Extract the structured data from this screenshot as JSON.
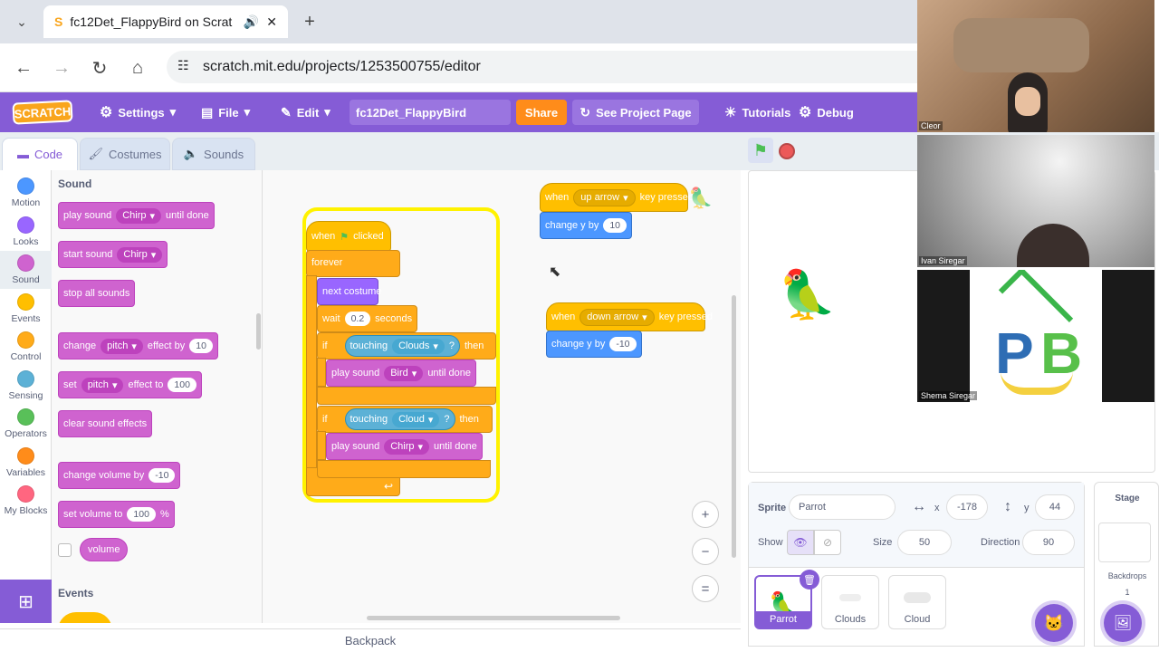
{
  "browser": {
    "tab_title": "fc12Det_FlappyBird on Scrat",
    "url": "scratch.mit.edu/projects/1253500755/editor",
    "icons": [
      "back-icon",
      "forward-icon",
      "reload-icon",
      "home-icon",
      "site-settings-icon",
      "speaker-icon",
      "close-icon",
      "new-tab-icon"
    ]
  },
  "menubar": {
    "logo": "SCRATCH",
    "settings": "Settings",
    "file": "File",
    "edit": "Edit",
    "project_title": "fc12Det_FlappyBird",
    "share": "Share",
    "see_project": "See Project Page",
    "tutorials": "Tutorials",
    "debug": "Debug"
  },
  "tabs": {
    "code": "Code",
    "costumes": "Costumes",
    "sounds": "Sounds"
  },
  "categories": [
    {
      "label": "Motion",
      "color": "#4c97ff"
    },
    {
      "label": "Looks",
      "color": "#9966ff"
    },
    {
      "label": "Sound",
      "color": "#cf63cf"
    },
    {
      "label": "Events",
      "color": "#ffbf00"
    },
    {
      "label": "Control",
      "color": "#ffab19"
    },
    {
      "label": "Sensing",
      "color": "#5cb1d6"
    },
    {
      "label": "Operators",
      "color": "#59c059"
    },
    {
      "label": "Variables",
      "color": "#ff8c1a"
    },
    {
      "label": "My Blocks",
      "color": "#ff6680"
    }
  ],
  "palette": {
    "heading": "Sound",
    "events_heading": "Events",
    "play_until": {
      "a": "play sound",
      "sound": "Chirp",
      "b": "until done"
    },
    "start_sound": {
      "a": "start sound",
      "sound": "Chirp"
    },
    "stop_all": "stop all sounds",
    "change_effect": {
      "a": "change",
      "effect": "pitch",
      "b": "effect by",
      "value": "10"
    },
    "set_effect": {
      "a": "set",
      "effect": "pitch",
      "b": "effect to",
      "value": "100"
    },
    "clear_effects": "clear sound effects",
    "change_volume": {
      "a": "change volume by",
      "value": "-10"
    },
    "set_volume": {
      "a": "set volume to",
      "value": "100",
      "unit": "%"
    },
    "volume": "volume"
  },
  "scripts": {
    "main": {
      "when": "when",
      "clicked": "clicked",
      "forever": "forever",
      "next_costume": "next costume",
      "wait": "wait",
      "wait_value": "0.2",
      "seconds": "seconds",
      "if1": "if",
      "touching": "touching",
      "target1": "Clouds",
      "q": "?",
      "then": "then",
      "play1": "play sound",
      "sound1": "Bird",
      "until": "until done",
      "if2": "if",
      "target2": "Cloud",
      "play2": "play sound",
      "sound2": "Chirp"
    },
    "up": {
      "when": "when",
      "key": "up arrow",
      "pressed": "key pressed",
      "change": "change y by",
      "value": "10"
    },
    "down": {
      "when": "when",
      "key": "down arrow",
      "pressed": "key pressed",
      "change": "change y by",
      "value": "-10"
    }
  },
  "backpack": "Backpack",
  "sprite_info": {
    "sprite_label": "Sprite",
    "sprite_name": "Parrot",
    "x_label": "x",
    "x": "-178",
    "y_label": "y",
    "y": "44",
    "show_label": "Show",
    "size_label": "Size",
    "size": "50",
    "direction_label": "Direction",
    "direction": "90"
  },
  "sprites": [
    {
      "name": "Parrot",
      "selected": true
    },
    {
      "name": "Clouds",
      "selected": false
    },
    {
      "name": "Cloud",
      "selected": false
    }
  ],
  "stage_panel": {
    "title": "Stage",
    "backdrops_label": "Backdrops",
    "backdrops_count": "1"
  },
  "participants": [
    {
      "name": "Cleor"
    },
    {
      "name": "Ivan Siregar"
    },
    {
      "name": "Shema Siregar"
    }
  ]
}
